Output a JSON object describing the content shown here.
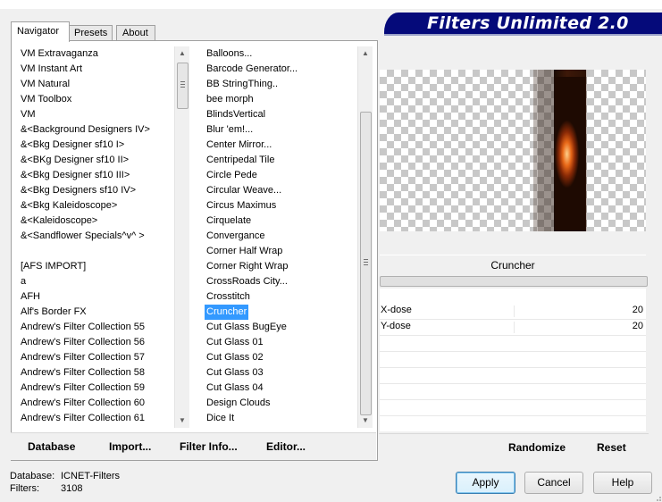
{
  "banner": {
    "title": "Filters Unlimited 2.0"
  },
  "tabs": [
    {
      "label": "Navigator",
      "active": true
    },
    {
      "label": "Presets",
      "active": false
    },
    {
      "label": "About",
      "active": false
    }
  ],
  "categories": [
    "VM Extravaganza",
    "VM Instant Art",
    "VM Natural",
    "VM Toolbox",
    "VM",
    "&<Background Designers IV>",
    "&<Bkg Designer sf10 I>",
    "&<BKg Designer sf10 II>",
    "&<Bkg Designer sf10 III>",
    "&<Bkg Designers sf10 IV>",
    "&<Bkg Kaleidoscope>",
    "&<Kaleidoscope>",
    "&<Sandflower Specials^v^ >",
    "",
    "[AFS IMPORT]",
    "a",
    "AFH",
    "Alf's Border FX",
    "Andrew's Filter Collection 55",
    "Andrew's Filter Collection 56",
    "Andrew's Filter Collection 57",
    "Andrew's Filter Collection 58",
    "Andrew's Filter Collection 59",
    "Andrew's Filter Collection 60",
    "Andrew's Filter Collection 61"
  ],
  "filters": [
    "Balloons...",
    "Barcode Generator...",
    "BB StringThing..",
    "bee morph",
    "BlindsVertical",
    "Blur 'em!...",
    "Center Mirror...",
    "Centripedal Tile",
    "Circle Pede",
    "Circular Weave...",
    "Circus Maximus",
    "Cirquelate",
    "Convergance",
    "Corner Half Wrap",
    "Corner Right Wrap",
    "CrossRoads City...",
    "Crosstitch",
    "Cruncher",
    "Cut Glass  BugEye",
    "Cut Glass 01",
    "Cut Glass 02",
    "Cut Glass 03",
    "Cut Glass 04",
    "Design Clouds",
    "Dice It"
  ],
  "selected_filter": "Cruncher",
  "left_buttons": {
    "database": "Database",
    "import": "Import...",
    "filter_info": "Filter Info...",
    "editor": "Editor..."
  },
  "filter_title": "Cruncher",
  "params": [
    {
      "name": "X-dose",
      "value": "20"
    },
    {
      "name": "Y-dose",
      "value": "20"
    }
  ],
  "right_buttons": {
    "randomize": "Randomize",
    "reset": "Reset"
  },
  "status": {
    "database_label": "Database:",
    "database_value": "ICNET-Filters",
    "filters_label": "Filters:",
    "filters_value": "3108"
  },
  "dialog_buttons": {
    "apply": "Apply",
    "cancel": "Cancel",
    "help": "Help"
  },
  "colors": {
    "banner": "#050a7a",
    "selection": "#3399ff"
  }
}
